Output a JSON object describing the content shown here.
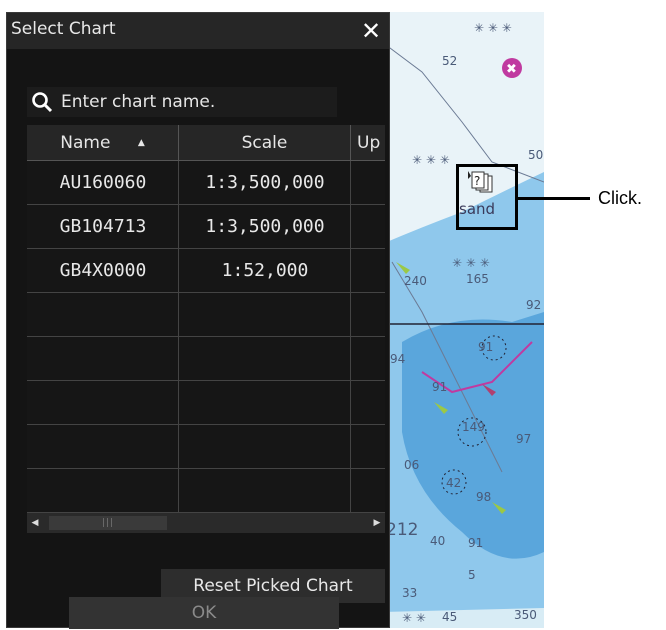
{
  "dialog": {
    "title": "Select Chart",
    "close_label": "✕",
    "search": {
      "placeholder": "Enter chart name.",
      "value": ""
    },
    "table": {
      "columns": [
        {
          "label": "Name",
          "sort": "▲"
        },
        {
          "label": "Scale"
        },
        {
          "label": "Up"
        }
      ],
      "rows": [
        {
          "name": "AU160060",
          "scale": "1:3,500,000"
        },
        {
          "name": "GB104713",
          "scale": "1:3,500,000"
        },
        {
          "name": "GB4X0000",
          "scale": "1:52,000"
        }
      ]
    },
    "scrollbar_grip": "|||",
    "reset_label": "Reset Picked Chart",
    "ok_label": "OK"
  },
  "map": {
    "numbers": [
      "52",
      "50",
      "240",
      "165",
      "92",
      "94",
      "91",
      "91",
      "149",
      "97",
      "06",
      "42",
      "98",
      "212",
      "40",
      "91",
      "5",
      "33",
      "45",
      "350"
    ],
    "feature_label": "sand"
  },
  "callout": {
    "text": "Click."
  },
  "colors": {
    "dialog_bg": "#141414",
    "sea_light": "#d8ecf5",
    "sea_blue": "#6fb4e1",
    "accent_magenta": "#c03aa0"
  }
}
